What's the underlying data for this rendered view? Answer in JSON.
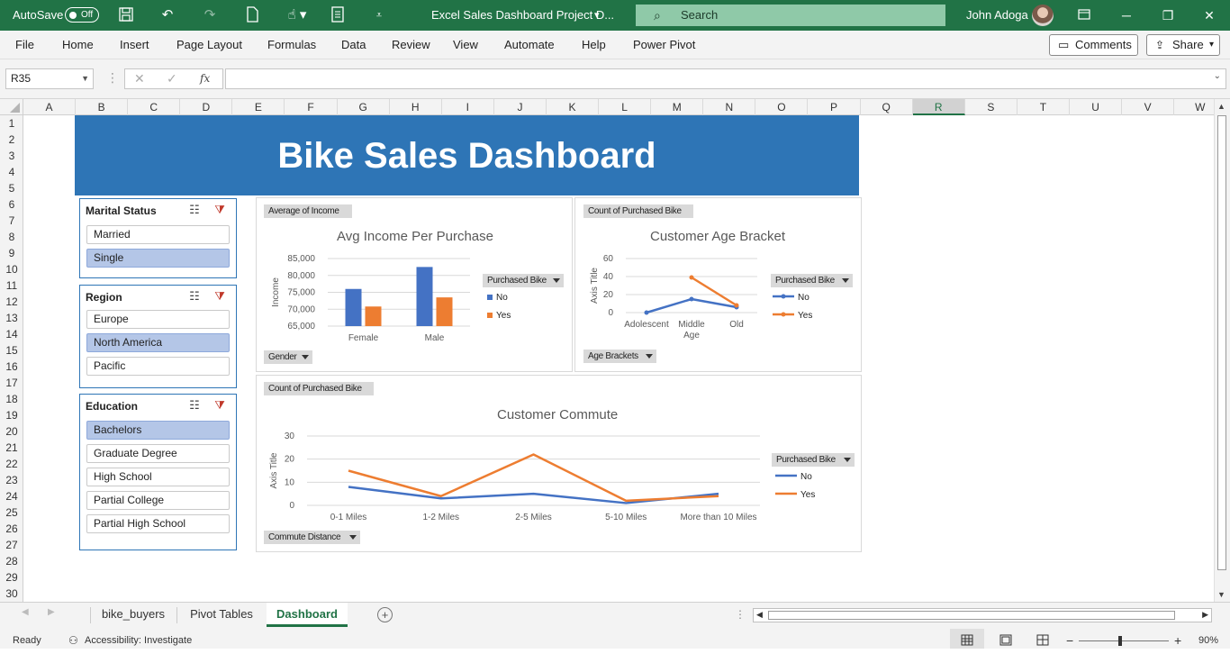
{
  "titlebar": {
    "autosave_label": "AutoSave",
    "autosave_state": "Off",
    "file_name": "Excel Sales Dashboard Project D...",
    "search_placeholder": "Search",
    "user_name": "John Adoga",
    "bg_color": "#217346"
  },
  "menu": [
    "File",
    "Home",
    "Insert",
    "Page Layout",
    "Formulas",
    "Data",
    "Review",
    "View",
    "Automate",
    "Help",
    "Power Pivot"
  ],
  "ribbon_buttons": {
    "comments": "Comments",
    "share": "Share"
  },
  "formula_bar": {
    "name_box": "R35",
    "fx": "fx",
    "formula": ""
  },
  "columns": [
    "A",
    "B",
    "C",
    "D",
    "E",
    "F",
    "G",
    "H",
    "I",
    "J",
    "K",
    "L",
    "M",
    "N",
    "O",
    "P",
    "Q",
    "R",
    "S",
    "T",
    "U",
    "V",
    "W"
  ],
  "selected_column": "R",
  "rows": [
    "1",
    "2",
    "3",
    "4",
    "5",
    "6",
    "7",
    "8",
    "9",
    "10",
    "11",
    "12",
    "13",
    "14",
    "15",
    "16",
    "17",
    "18",
    "19",
    "20",
    "21",
    "22",
    "23",
    "24",
    "25",
    "26",
    "27",
    "28",
    "29",
    "30"
  ],
  "dashboard": {
    "title": "Bike Sales Dashboard",
    "banner_color": "#2e75b6"
  },
  "slicers": [
    {
      "title": "Marital Status",
      "items": [
        {
          "label": "Married",
          "selected": false
        },
        {
          "label": "Single",
          "selected": true
        }
      ]
    },
    {
      "title": "Region",
      "items": [
        {
          "label": "Europe",
          "selected": false
        },
        {
          "label": "North America",
          "selected": true
        },
        {
          "label": "Pacific",
          "selected": false
        }
      ]
    },
    {
      "title": "Education",
      "items": [
        {
          "label": "Bachelors",
          "selected": true
        },
        {
          "label": "Graduate Degree",
          "selected": false
        },
        {
          "label": "High School",
          "selected": false
        },
        {
          "label": "Partial College",
          "selected": false
        },
        {
          "label": "Partial High School",
          "selected": false
        }
      ]
    }
  ],
  "charts_ui": {
    "income": {
      "value_field": "Average of Income",
      "row_field": "Gender",
      "legend_field": "Purchased Bike"
    },
    "age": {
      "value_field": "Count of Purchased Bike",
      "row_field": "Age Brackets",
      "legend_field": "Purchased Bike"
    },
    "commute": {
      "value_field": "Count of Purchased Bike",
      "row_field": "Commute Distance",
      "legend_field": "Purchased Bike"
    }
  },
  "chart_data": [
    {
      "type": "bar",
      "title": "Avg Income Per Purchase",
      "xlabel": "",
      "ylabel": "Income",
      "categories": [
        "Female",
        "Male"
      ],
      "series": [
        {
          "name": "No",
          "values": [
            76000,
            82500
          ],
          "color": "#4472c4"
        },
        {
          "name": "Yes",
          "values": [
            70800,
            73500
          ],
          "color": "#ed7d31"
        }
      ],
      "ylim": [
        65000,
        85000
      ],
      "yticks": [
        "85,000",
        "80,000",
        "75,000",
        "70,000",
        "65,000"
      ],
      "grid": true,
      "legend_title": "Purchased Bike",
      "legend_position": "right"
    },
    {
      "type": "line",
      "title": "Customer Age Bracket",
      "xlabel": "",
      "ylabel": "Axis Title",
      "categories": [
        "Adolescent",
        "Middle Age",
        "Old"
      ],
      "category_lines": [
        [
          "Adolescent"
        ],
        [
          "Middle",
          "Age"
        ],
        [
          "Old"
        ]
      ],
      "series": [
        {
          "name": "No",
          "values": [
            0,
            15,
            6
          ],
          "color": "#4472c4"
        },
        {
          "name": "Yes",
          "values": [
            null,
            39,
            8
          ],
          "color": "#ed7d31"
        }
      ],
      "ylim": [
        0,
        60
      ],
      "yticks": [
        "60",
        "40",
        "20",
        "0"
      ],
      "grid": true,
      "legend_title": "Purchased Bike",
      "legend_position": "right"
    },
    {
      "type": "line",
      "title": "Customer Commute",
      "xlabel": "",
      "ylabel": "Axis Title",
      "categories": [
        "0-1 Miles",
        "1-2 Miles",
        "2-5 Miles",
        "5-10 Miles",
        "More than 10 Miles"
      ],
      "series": [
        {
          "name": "No",
          "values": [
            8,
            3,
            5,
            1,
            5
          ],
          "color": "#4472c4"
        },
        {
          "name": "Yes",
          "values": [
            15,
            4,
            22,
            2,
            4
          ],
          "color": "#ed7d31"
        }
      ],
      "ylim": [
        0,
        30
      ],
      "yticks": [
        "30",
        "20",
        "10",
        "0"
      ],
      "grid": true,
      "legend_title": "Purchased Bike",
      "legend_position": "right"
    }
  ],
  "sheet_tabs": [
    {
      "label": "bike_buyers",
      "active": false
    },
    {
      "label": "Pivot Tables",
      "active": false
    },
    {
      "label": "Dashboard",
      "active": true
    }
  ],
  "statusbar": {
    "ready": "Ready",
    "accessibility": "Accessibility: Investigate",
    "zoom": "90%"
  }
}
